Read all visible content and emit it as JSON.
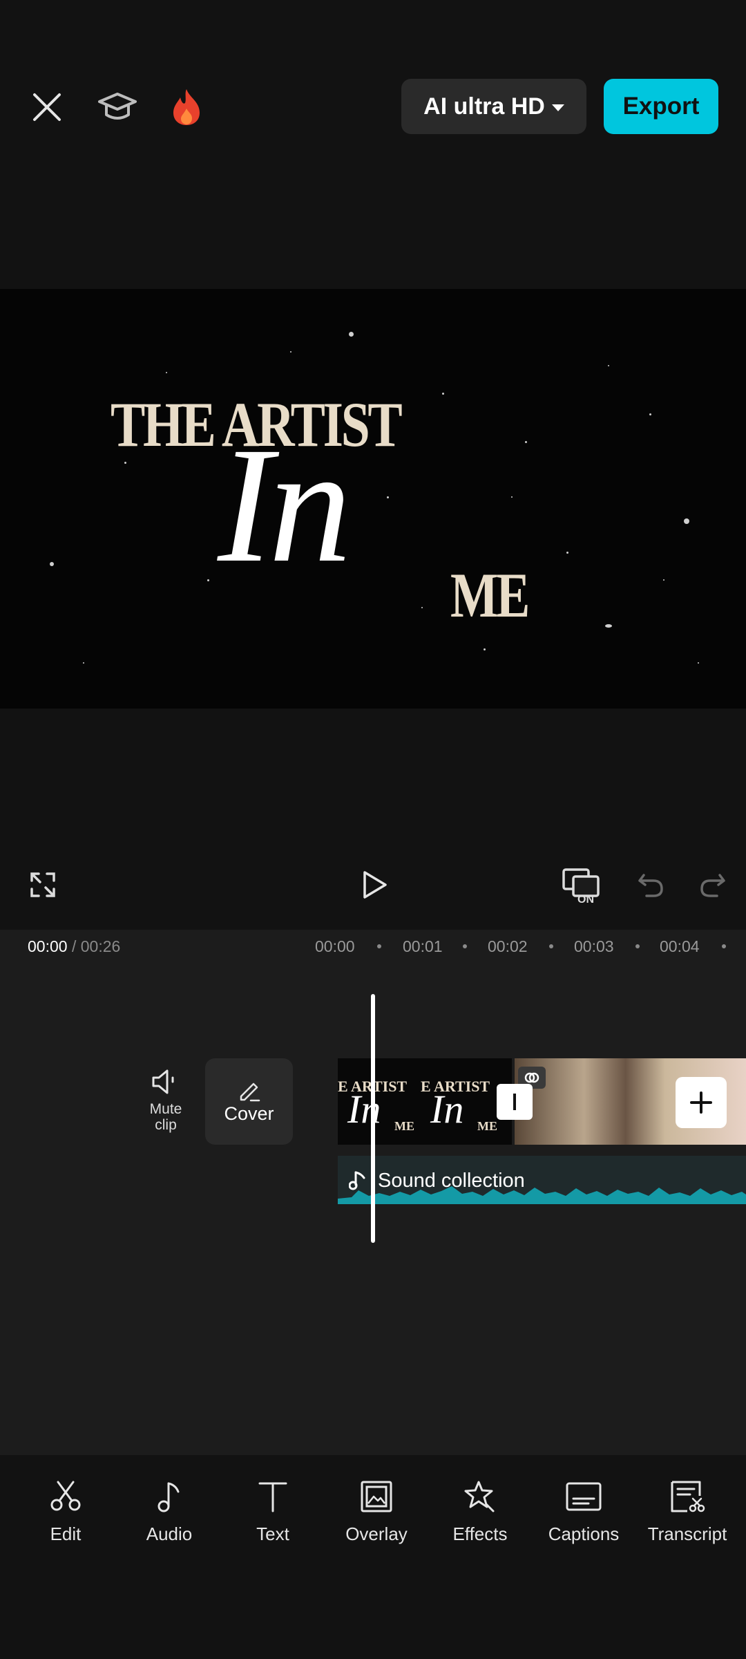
{
  "topbar": {
    "close_icon": "close-icon",
    "tutorial_icon": "graduation-cap-icon",
    "trending_icon": "fire-icon",
    "quality_label": "AI ultra HD",
    "export_label": "Export"
  },
  "preview": {
    "line1": "THE ARTIST",
    "line2": "In",
    "line3": "ME"
  },
  "controls": {
    "fullscreen_icon": "fullscreen-icon",
    "play_icon": "play-icon",
    "preview_mode_icon": "preview-on-icon",
    "undo_icon": "undo-icon",
    "redo_icon": "redo-icon"
  },
  "timeline": {
    "current_time": "00:00",
    "separator": " / ",
    "total_time": "00:26",
    "ruler": [
      "00:00",
      "00:01",
      "00:02",
      "00:03",
      "00:04"
    ]
  },
  "tracks": {
    "mute_label": "Mute clip",
    "cover_label": "Cover",
    "audio_label": "Sound collection"
  },
  "toolbar": [
    {
      "label": "Edit",
      "icon": "scissors-icon"
    },
    {
      "label": "Audio",
      "icon": "music-note-icon"
    },
    {
      "label": "Text",
      "icon": "text-icon"
    },
    {
      "label": "Overlay",
      "icon": "overlay-icon"
    },
    {
      "label": "Effects",
      "icon": "effects-icon"
    },
    {
      "label": "Captions",
      "icon": "captions-icon"
    },
    {
      "label": "Transcript",
      "icon": "transcript-icon"
    }
  ],
  "colors": {
    "accent": "#00c6de",
    "background": "#121212",
    "audio_wave": "#149aa6"
  }
}
